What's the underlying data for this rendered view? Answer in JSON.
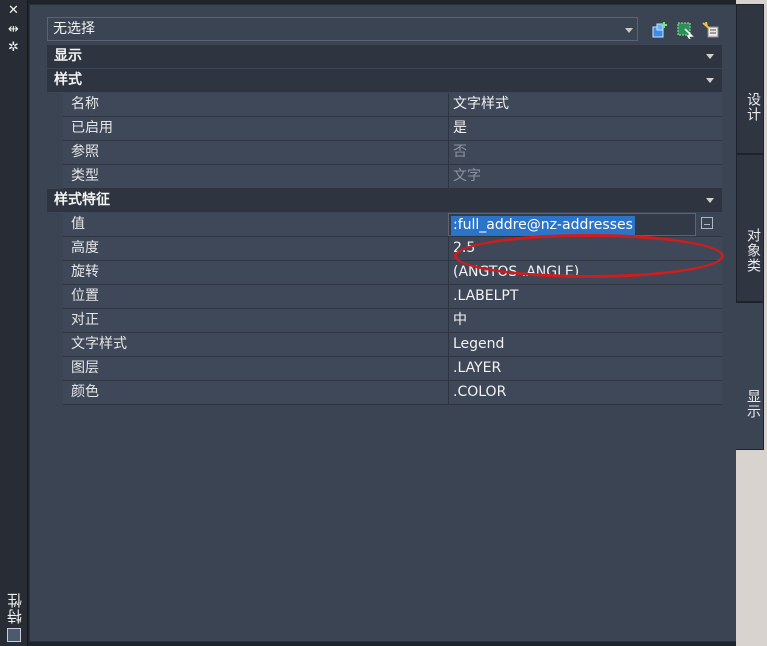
{
  "window": {
    "title_vertical": "特性",
    "controls": [
      "close-icon",
      "autohide-icon",
      "options-icon"
    ]
  },
  "selector": {
    "value": "无选择",
    "toolbar_icons": [
      "toggle-pickadd-icon",
      "select-objects-icon",
      "quick-select-icon"
    ]
  },
  "categories": {
    "display": "显示",
    "style": "样式",
    "style_props": "样式特征"
  },
  "style_rows": [
    {
      "name": "名称",
      "value": "文字样式",
      "dim": false
    },
    {
      "name": "已启用",
      "value": "是",
      "dim": false
    },
    {
      "name": "参照",
      "value": "否",
      "dim": true
    },
    {
      "name": "类型",
      "value": "文字",
      "dim": true
    }
  ],
  "value_row": {
    "name": "值",
    "value": ":full_addre@nz-addresses"
  },
  "prop_rows": [
    {
      "name": "高度",
      "value": "2.5"
    },
    {
      "name": "旋转",
      "value": "(ANGTOS .ANGLE)"
    },
    {
      "name": "位置",
      "value": ".LABELPT"
    },
    {
      "name": "对正",
      "value": "中"
    },
    {
      "name": "文字样式",
      "value": "Legend"
    },
    {
      "name": "图层",
      "value": ".LAYER"
    },
    {
      "name": "颜色",
      "value": ".COLOR"
    }
  ],
  "tabs": [
    "设计",
    "对象类",
    "显示"
  ],
  "colors": {
    "panel": "#3b4453",
    "selection": "#2b74c8",
    "annotation": "#d21c1c"
  }
}
